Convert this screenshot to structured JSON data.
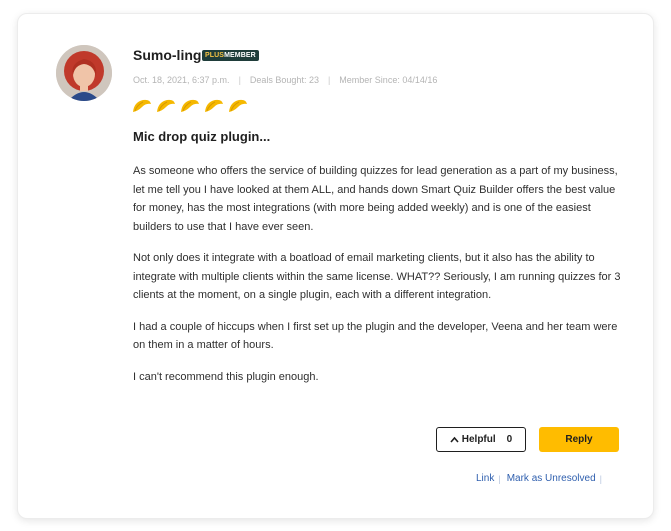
{
  "review": {
    "username": "Sumo-ling",
    "badge": {
      "part1": "PLUS",
      "part2": "MEMBER"
    },
    "meta": {
      "date": "Oct. 18, 2021, 6:37 p.m.",
      "deals_bought": "Deals Bought: 23",
      "member_since": "Member Since: 04/14/16",
      "separator": "|"
    },
    "rating": {
      "value": 5,
      "max": 5,
      "icon": "taco-icon",
      "color": "#f5b800"
    },
    "title": "Mic drop quiz plugin...",
    "paragraphs": [
      "As someone who offers the service of building quizzes for lead generation as a part of my business, let me tell you I have looked at them ALL, and hands down Smart Quiz Builder offers the best value for money, has the most integrations (with more being added weekly) and is one of the easiest builders to use that I have ever seen.",
      "Not only does it integrate with a boatload of email marketing clients, but it also has the ability to integrate with multiple clients within the same license. WHAT?? Seriously, I am running quizzes for 3 clients at the moment, on a single plugin, each with a different integration.",
      "I had a couple of hiccups when I first set up the plugin and the developer, Veena and her team were on them in a matter of hours.",
      "I can't recommend this plugin enough."
    ]
  },
  "actions": {
    "helpful_label": "Helpful",
    "helpful_count": "0",
    "reply_label": "Reply",
    "link_label": "Link",
    "unresolved_label": "Mark as Unresolved",
    "link_separator": "|"
  },
  "colors": {
    "accent": "#ffbc00",
    "badge_bg": "#1f3d3a",
    "link": "#2f5fae"
  }
}
